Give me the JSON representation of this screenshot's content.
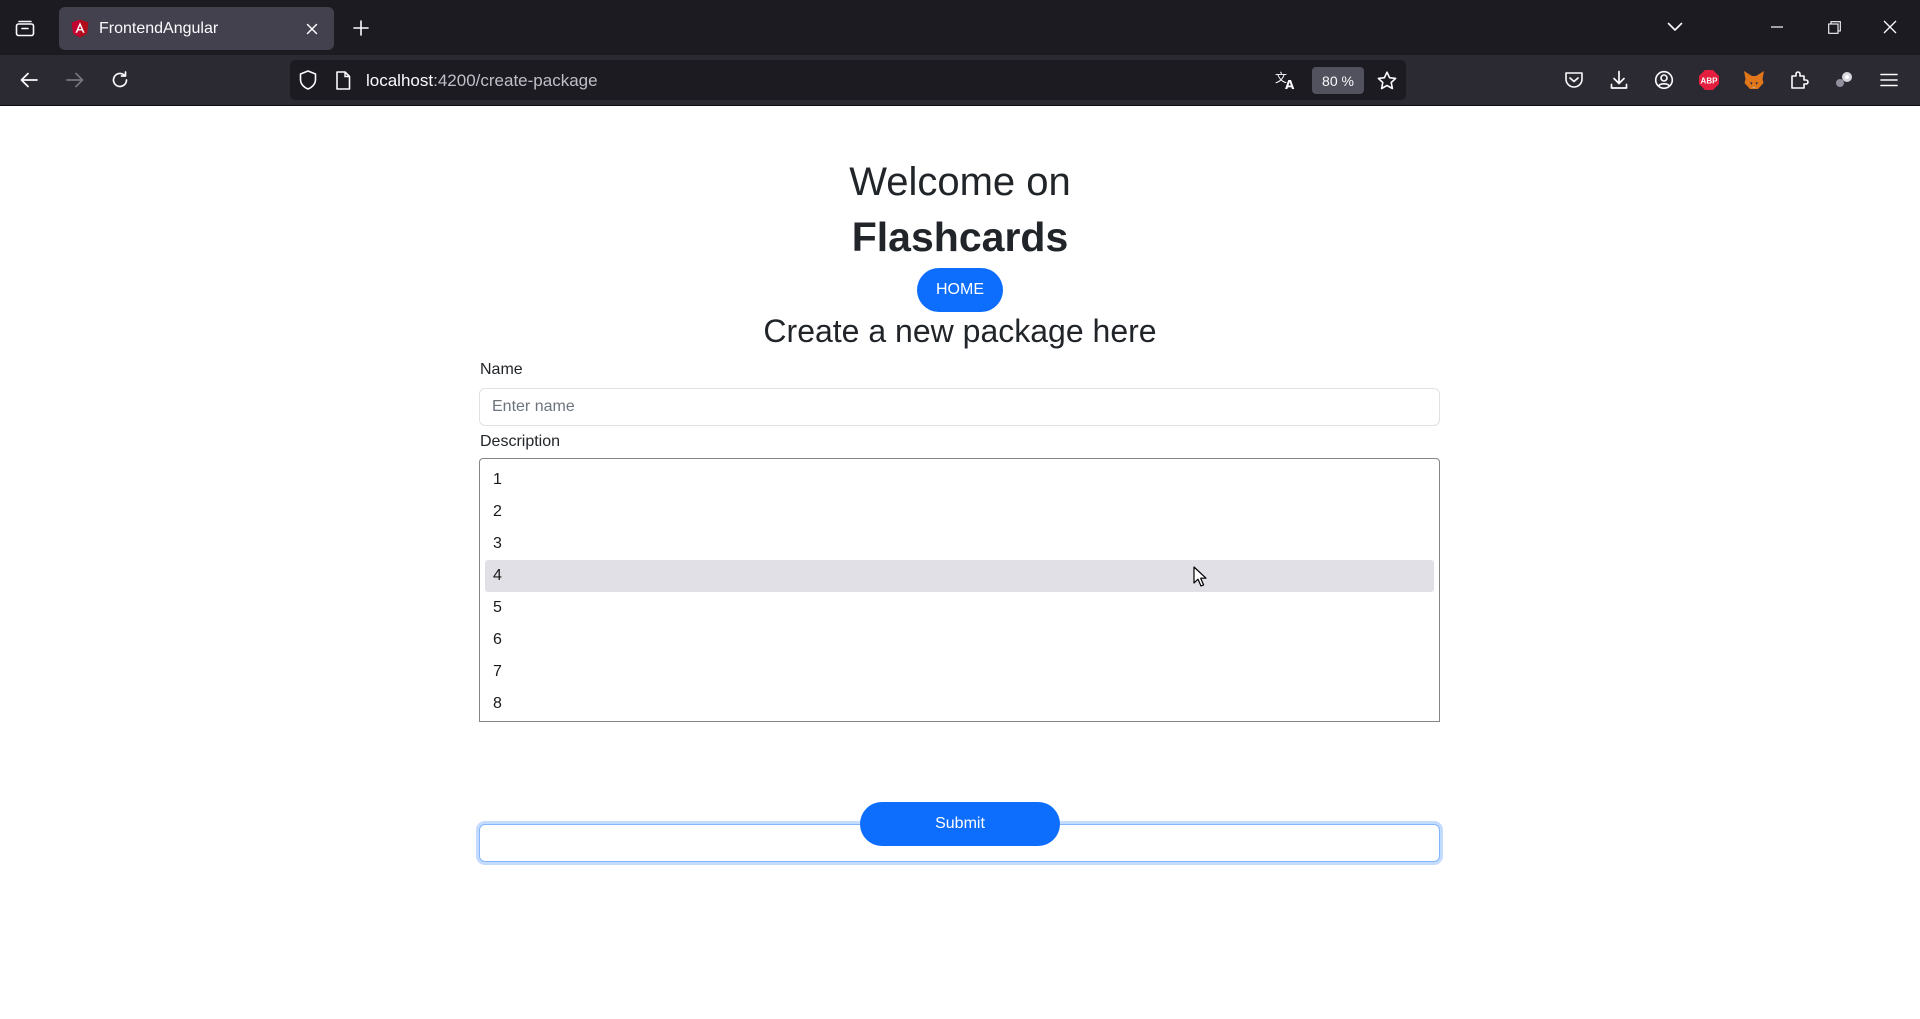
{
  "browser": {
    "tab": {
      "title": "FrontendAngular"
    },
    "url": {
      "host": "localhost",
      "rest": ":4200/create-package"
    },
    "zoom": "80 %",
    "icons": {
      "tab_overview": "tab-overview-icon",
      "favicon": "angular-icon",
      "tab_close": "close-icon",
      "new_tab": "plus-icon",
      "list_tabs": "chevron-down-icon",
      "back": "arrow-left-icon",
      "forward": "arrow-right-icon",
      "reload": "reload-icon",
      "tracking": "shield-icon",
      "page_info": "page-icon",
      "translate": "translate-icon",
      "bookmark": "star-icon",
      "pocket": "pocket-icon",
      "downloads": "download-icon",
      "account": "account-icon",
      "adblock": "abp-icon",
      "metamask": "fox-icon",
      "extensions": "puzzle-icon",
      "extension2": "extension-icon",
      "menu": "hamburger-icon"
    },
    "abp_label": "ABP"
  },
  "page": {
    "welcome": "Welcome on",
    "brand": "Flashcards",
    "home_button": "HOME",
    "subtitle": "Create a new package here",
    "form": {
      "name_label": "Name",
      "name_placeholder": "Enter name",
      "description_label": "Description",
      "dropdown_options": [
        "1",
        "2",
        "3",
        "4",
        "5",
        "6",
        "7",
        "8"
      ],
      "highlighted_option": "4",
      "submit_label": "Submit"
    }
  },
  "colors": {
    "primary": "#0d6efd",
    "chrome_dark": "#1c1b22",
    "toolbar": "#2b2a33",
    "abp_red": "#e41e3f"
  }
}
